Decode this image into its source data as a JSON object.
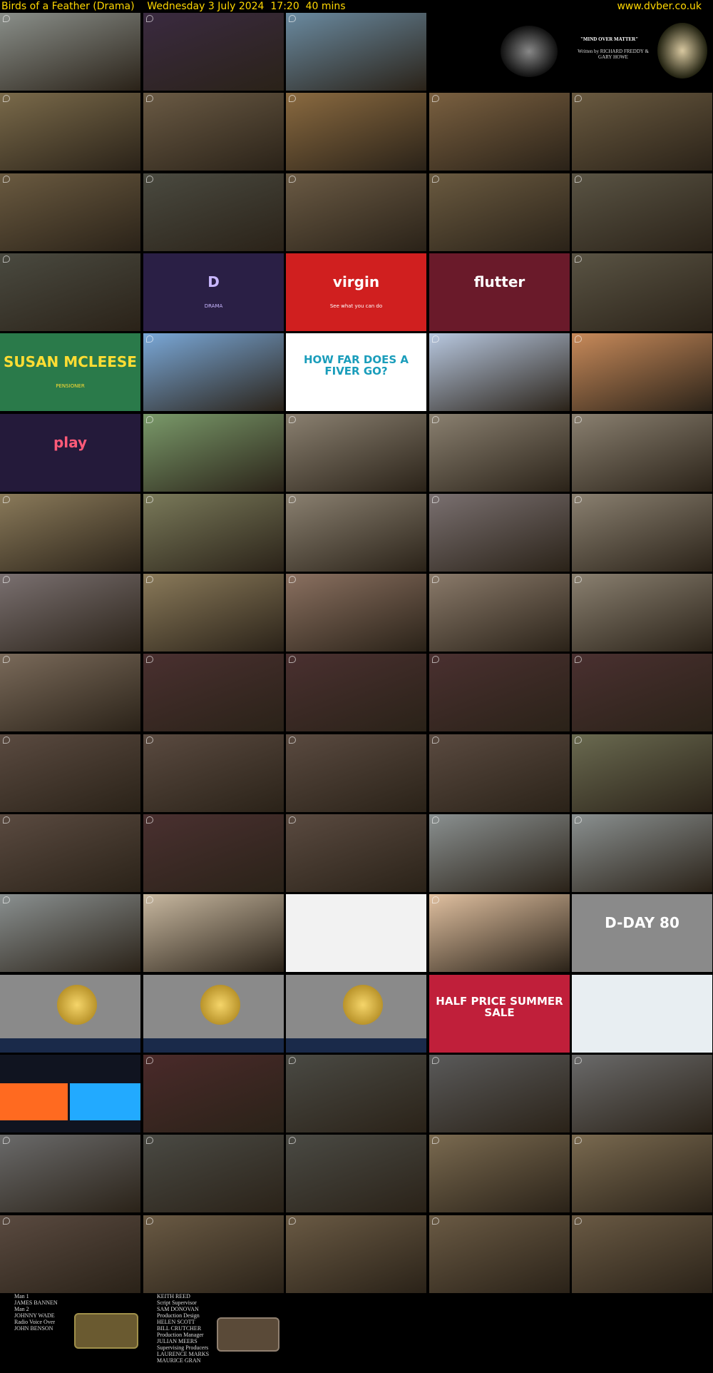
{
  "header": {
    "title": "Birds of a Feather (Drama)",
    "datetime": "Wednesday 3 July 2024",
    "time": "17:20",
    "duration": "40 mins",
    "site": "www.dvber.co.uk"
  },
  "tiles": [
    {
      "bg": "#8a8f8a",
      "kind": "scene"
    },
    {
      "bg": "#3a2a40",
      "kind": "scene"
    },
    {
      "bg": "#6a8aa0",
      "kind": "scene"
    },
    {
      "bg": "#000000",
      "kind": "title1"
    },
    {
      "bg": "#000000",
      "kind": "title2",
      "text": "\"MIND OVER MATTER\"",
      "sub": "Written by RICHARD FREDDY & GARY HOWE"
    },
    {
      "bg": "#7a6a4a",
      "kind": "scene"
    },
    {
      "bg": "#6a5a44",
      "kind": "scene"
    },
    {
      "bg": "#8a6a40",
      "kind": "scene"
    },
    {
      "bg": "#7a6040",
      "kind": "scene"
    },
    {
      "bg": "#6a5a40",
      "kind": "scene"
    },
    {
      "bg": "#6a5a40",
      "kind": "scene"
    },
    {
      "bg": "#4a4a40",
      "kind": "scene"
    },
    {
      "bg": "#6a5a44",
      "kind": "scene"
    },
    {
      "bg": "#6a5a40",
      "kind": "scene"
    },
    {
      "bg": "#5a5444",
      "kind": "scene"
    },
    {
      "bg": "#4a4a40",
      "kind": "scene"
    },
    {
      "bg": "#2a1f45",
      "kind": "ad",
      "text": "D",
      "sub": "DRAMA",
      "color": "#c9b7ff"
    },
    {
      "bg": "#d01f1f",
      "kind": "ad",
      "text": "virgin",
      "sub": "See what you can do",
      "color": "#ffffff"
    },
    {
      "bg": "#6a1a2a",
      "kind": "ad",
      "text": "flutter",
      "sub": "",
      "color": "#ffffff"
    },
    {
      "bg": "#5a5444",
      "kind": "scene"
    },
    {
      "bg": "#2a7a4a",
      "kind": "ad",
      "text": "SUSAN MCLEESE",
      "sub": "PENSIONER",
      "color": "#ffdd33"
    },
    {
      "bg": "#7aa8d8",
      "kind": "scene"
    },
    {
      "bg": "#ffffff",
      "kind": "ad",
      "text": "HOW FAR DOES A FIVER GO?",
      "sub": "",
      "color": "#1a9dbb"
    },
    {
      "bg": "#b8c8e0",
      "kind": "scene"
    },
    {
      "bg": "#c88a5a",
      "kind": "scene"
    },
    {
      "bg": "#241a3a",
      "kind": "ad",
      "text": "play",
      "sub": "",
      "color": "#ff5a78"
    },
    {
      "bg": "#7a9a6a",
      "kind": "scene"
    },
    {
      "bg": "#8a8070",
      "kind": "scene"
    },
    {
      "bg": "#8a8070",
      "kind": "scene"
    },
    {
      "bg": "#8a8070",
      "kind": "scene"
    },
    {
      "bg": "#8a7a5a",
      "kind": "scene"
    },
    {
      "bg": "#7a7a5a",
      "kind": "scene"
    },
    {
      "bg": "#8a8070",
      "kind": "scene"
    },
    {
      "bg": "#7a7070",
      "kind": "scene"
    },
    {
      "bg": "#8a8070",
      "kind": "scene"
    },
    {
      "bg": "#7a7070",
      "kind": "scene"
    },
    {
      "bg": "#8a7a5a",
      "kind": "scene"
    },
    {
      "bg": "#8a7060",
      "kind": "scene"
    },
    {
      "bg": "#8a7a6a",
      "kind": "scene"
    },
    {
      "bg": "#8a8070",
      "kind": "scene"
    },
    {
      "bg": "#7a6a5a",
      "kind": "scene"
    },
    {
      "bg": "#4a3030",
      "kind": "scene"
    },
    {
      "bg": "#4a3030",
      "kind": "scene"
    },
    {
      "bg": "#4a3030",
      "kind": "scene"
    },
    {
      "bg": "#4a3030",
      "kind": "scene"
    },
    {
      "bg": "#5a4a40",
      "kind": "scene"
    },
    {
      "bg": "#5a4a40",
      "kind": "scene"
    },
    {
      "bg": "#5a4a40",
      "kind": "scene"
    },
    {
      "bg": "#5a4a40",
      "kind": "scene"
    },
    {
      "bg": "#6a6a50",
      "kind": "scene"
    },
    {
      "bg": "#5a4a40",
      "kind": "scene"
    },
    {
      "bg": "#4a3030",
      "kind": "scene"
    },
    {
      "bg": "#5a4a40",
      "kind": "scene"
    },
    {
      "bg": "#8a9090",
      "kind": "scene"
    },
    {
      "bg": "#8a9090",
      "kind": "scene"
    },
    {
      "bg": "#8a9090",
      "kind": "scene"
    },
    {
      "bg": "#c8b8a0",
      "kind": "scene"
    },
    {
      "bg": "#f2f2f2",
      "kind": "ad",
      "text": "",
      "sub": "",
      "color": "#333"
    },
    {
      "bg": "#e0c0a0",
      "kind": "scene"
    },
    {
      "bg": "#8a8a8a",
      "kind": "ad",
      "text": "D-DAY 80",
      "sub": "",
      "color": "#ffffff"
    },
    {
      "bg": "#8a8a8a",
      "kind": "coin"
    },
    {
      "bg": "#8a8a8a",
      "kind": "coin"
    },
    {
      "bg": "#8a8a8a",
      "kind": "coin"
    },
    {
      "bg": "#c01f3a",
      "kind": "ad",
      "text": "HALF PRICE SUMMER SALE",
      "sub": "",
      "color": "#ffffff"
    },
    {
      "bg": "#e8eef2",
      "kind": "ad",
      "text": "",
      "sub": "",
      "color": "#333"
    },
    {
      "bg": "#101420",
      "kind": "panels"
    },
    {
      "bg": "#4a2a2a",
      "kind": "scene"
    },
    {
      "bg": "#4a4a44",
      "kind": "scene"
    },
    {
      "bg": "#5a5a5a",
      "kind": "scene"
    },
    {
      "bg": "#6a6a6a",
      "kind": "scene"
    },
    {
      "bg": "#6a6a6a",
      "kind": "scene"
    },
    {
      "bg": "#4a4a44",
      "kind": "scene"
    },
    {
      "bg": "#4a4a44",
      "kind": "scene"
    },
    {
      "bg": "#7a6a50",
      "kind": "scene"
    },
    {
      "bg": "#7a6a50",
      "kind": "scene"
    },
    {
      "bg": "#5a4a40",
      "kind": "scene"
    },
    {
      "bg": "#6a5a44",
      "kind": "scene"
    },
    {
      "bg": "#6a5a44",
      "kind": "scene"
    },
    {
      "bg": "#6a5a44",
      "kind": "scene"
    },
    {
      "bg": "#6a5a44",
      "kind": "scene"
    }
  ],
  "credits_col1": [
    "Man 1",
    "JAMES BANNEN",
    "Man 2",
    "JOHNNY WADE",
    "Radio Voice Over",
    "JOHN BENSON"
  ],
  "credits_col2": [
    "KEITH REED",
    "Script Supervisor",
    "SAM DONOVAN",
    "Production Design",
    "HELEN SCOTT",
    "BILL CRUTCHER",
    "Production Manager",
    "JULIAN MEERS",
    "Supervising Producers",
    "LAURENCE MARKS",
    "MAURICE GRAN"
  ]
}
